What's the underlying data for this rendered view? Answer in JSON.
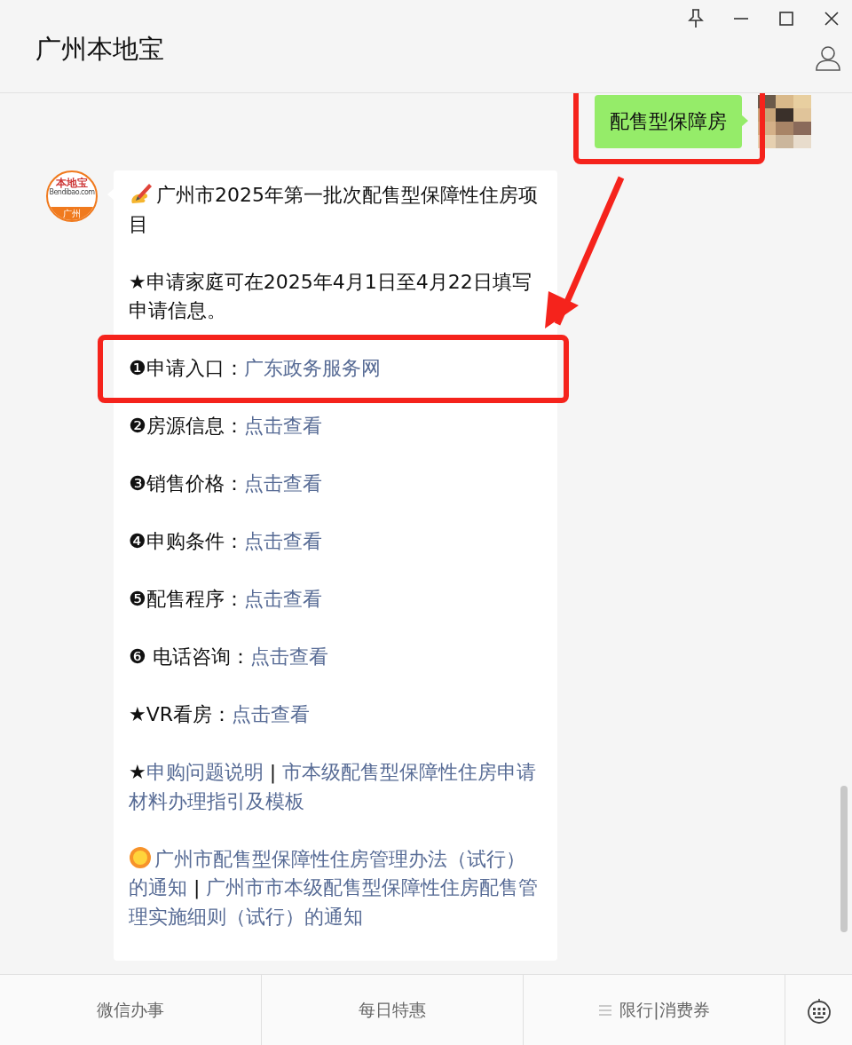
{
  "window": {
    "title": "广州本地宝"
  },
  "messages": [
    {
      "kind": "sent",
      "text": "配售型保障房",
      "highlighted": true
    },
    {
      "kind": "received",
      "avatar": {
        "brand": "本地宝",
        "site": "Bendibao.com",
        "city": "广州"
      },
      "paragraphs": [
        {
          "kind": "hand-note",
          "parts": [
            {
              "text": "广州市2025年第一批次配售型保障性住房项目",
              "link": false
            }
          ]
        },
        {
          "parts": [
            {
              "text": "★申请家庭可在2025年4月1日至4月22日填写申请信息。",
              "link": false
            }
          ]
        },
        {
          "highlighted": true,
          "parts": [
            {
              "text": "❶申请入口：",
              "link": false
            },
            {
              "text": "广东政务服务网",
              "link": true
            }
          ]
        },
        {
          "parts": [
            {
              "text": "❷房源信息：",
              "link": false
            },
            {
              "text": "点击查看",
              "link": true
            }
          ]
        },
        {
          "parts": [
            {
              "text": "❸销售价格：",
              "link": false
            },
            {
              "text": "点击查看",
              "link": true
            }
          ]
        },
        {
          "parts": [
            {
              "text": "❹申购条件：",
              "link": false
            },
            {
              "text": "点击查看",
              "link": true
            }
          ]
        },
        {
          "parts": [
            {
              "text": "❺配售程序：",
              "link": false
            },
            {
              "text": "点击查看",
              "link": true
            }
          ]
        },
        {
          "parts": [
            {
              "text": "❻ 电话咨询：",
              "link": false
            },
            {
              "text": "点击查看",
              "link": true
            }
          ]
        },
        {
          "parts": [
            {
              "text": "★VR看房：",
              "link": false
            },
            {
              "text": "点击查看",
              "link": true
            }
          ]
        },
        {
          "parts": [
            {
              "text": "★",
              "link": false
            },
            {
              "text": "申购问题说明",
              "link": true
            },
            {
              "text": " | ",
              "link": false
            },
            {
              "text": "市本级配售型保障性住房申请材料办理指引及模板",
              "link": true
            }
          ]
        },
        {
          "kind": "sun-note",
          "parts": [
            {
              "text": "广州市配售型保障性住房管理办法（试行）的通知",
              "link": true
            },
            {
              "text": " | ",
              "link": false
            },
            {
              "text": "广州市市本级配售型保障性住房配售管理实施细则（试行）的通知",
              "link": true
            }
          ]
        }
      ]
    }
  ],
  "annotation_arrow": true,
  "menu": [
    {
      "label": "微信办事",
      "submenu": false
    },
    {
      "label": "每日特惠",
      "submenu": false
    },
    {
      "label": "限行|消费券",
      "submenu": true
    }
  ]
}
